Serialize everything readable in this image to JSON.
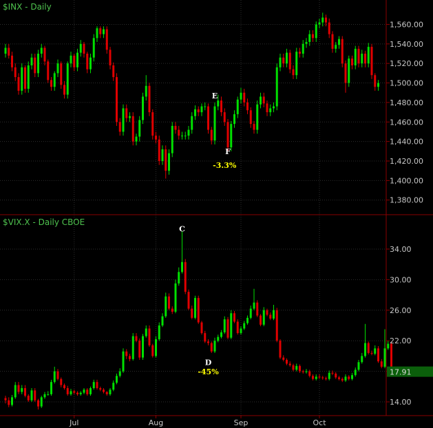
{
  "colors": {
    "background": "#000000",
    "up": "#00e000",
    "down": "#e00000",
    "grid": "#2e2e2e",
    "axis": "#8a0000",
    "text": "#c8c8c8",
    "title": "#4ec24e",
    "annotation_letter": "#ffffff",
    "annotation_pct": "#ffff00"
  },
  "chart_data": [
    {
      "type": "candlestick",
      "title": "$INX - Daily",
      "ylim": [
        1365,
        1585
      ],
      "yticks": [
        1380,
        1400,
        1420,
        1440,
        1460,
        1480,
        1500,
        1520,
        1540,
        1560
      ],
      "ytick_labels": [
        "1,380.00",
        "1,400.00",
        "1,420.00",
        "1,440.00",
        "1,460.00",
        "1,480.00",
        "1,500.00",
        "1,520.00",
        "1,540.00",
        "1,560.00"
      ],
      "grid": true,
      "annotations": [
        {
          "label": "E",
          "x": 64,
          "y": 1484
        },
        {
          "label": "F",
          "x": 68,
          "y": 1427
        },
        {
          "label": "-3.3%",
          "x": 67,
          "y": 1413
        }
      ],
      "series": {
        "close": [
          1536,
          1528,
          1516,
          1506,
          1492,
          1516,
          1494,
          1518,
          1526,
          1510,
          1530,
          1536,
          1522,
          1503,
          1496,
          1510,
          1520,
          1498,
          1488,
          1520,
          1528,
          1516,
          1531,
          1540,
          1530,
          1514,
          1526,
          1546,
          1556,
          1550,
          1555,
          1534,
          1518,
          1506,
          1460,
          1450,
          1474,
          1464,
          1466,
          1440,
          1445,
          1462,
          1486,
          1497,
          1470,
          1446,
          1442,
          1420,
          1432,
          1410,
          1428,
          1456,
          1452,
          1446,
          1446,
          1446,
          1452,
          1466,
          1473,
          1470,
          1476,
          1476,
          1452,
          1441,
          1476,
          1482,
          1470,
          1460,
          1434,
          1458,
          1468,
          1483,
          1490,
          1480,
          1472,
          1458,
          1452,
          1478,
          1486,
          1479,
          1470,
          1474,
          1476,
          1516,
          1526,
          1520,
          1531,
          1514,
          1508,
          1532,
          1530,
          1540,
          1542,
          1550,
          1546,
          1560,
          1562,
          1567,
          1562,
          1550,
          1535,
          1539,
          1545,
          1520,
          1500,
          1525,
          1518,
          1535,
          1520,
          1530,
          1520,
          1537,
          1508,
          1496,
          1500
        ],
        "open": [
          1530,
          1536,
          1528,
          1516,
          1506,
          1492,
          1516,
          1494,
          1518,
          1526,
          1510,
          1530,
          1536,
          1522,
          1503,
          1496,
          1510,
          1520,
          1498,
          1488,
          1520,
          1528,
          1516,
          1531,
          1540,
          1530,
          1514,
          1526,
          1546,
          1556,
          1550,
          1555,
          1534,
          1518,
          1506,
          1460,
          1450,
          1474,
          1464,
          1466,
          1440,
          1445,
          1462,
          1486,
          1497,
          1470,
          1446,
          1442,
          1420,
          1432,
          1410,
          1428,
          1456,
          1452,
          1446,
          1446,
          1446,
          1452,
          1466,
          1473,
          1470,
          1476,
          1476,
          1452,
          1441,
          1476,
          1482,
          1470,
          1460,
          1434,
          1458,
          1468,
          1483,
          1490,
          1480,
          1472,
          1458,
          1452,
          1478,
          1486,
          1479,
          1470,
          1474,
          1476,
          1516,
          1526,
          1520,
          1531,
          1514,
          1508,
          1532,
          1530,
          1540,
          1542,
          1550,
          1546,
          1560,
          1562,
          1567,
          1562,
          1550,
          1535,
          1539,
          1545,
          1520,
          1500,
          1525,
          1518,
          1535,
          1520,
          1530,
          1520,
          1537,
          1508,
          1496
        ],
        "high": [
          1540,
          1540,
          1532,
          1520,
          1510,
          1520,
          1518,
          1522,
          1530,
          1530,
          1534,
          1540,
          1538,
          1524,
          1506,
          1512,
          1524,
          1522,
          1502,
          1522,
          1532,
          1530,
          1535,
          1544,
          1542,
          1532,
          1530,
          1550,
          1558,
          1558,
          1558,
          1558,
          1537,
          1521,
          1510,
          1464,
          1478,
          1478,
          1470,
          1470,
          1448,
          1466,
          1490,
          1508,
          1500,
          1473,
          1450,
          1446,
          1436,
          1436,
          1432,
          1460,
          1460,
          1456,
          1450,
          1450,
          1456,
          1470,
          1477,
          1476,
          1479,
          1480,
          1479,
          1455,
          1480,
          1488,
          1486,
          1474,
          1463,
          1461,
          1472,
          1486,
          1495,
          1494,
          1484,
          1475,
          1461,
          1482,
          1490,
          1490,
          1482,
          1478,
          1480,
          1520,
          1530,
          1530,
          1535,
          1534,
          1518,
          1536,
          1536,
          1544,
          1546,
          1554,
          1554,
          1563,
          1566,
          1572,
          1570,
          1566,
          1553,
          1542,
          1548,
          1548,
          1523,
          1528,
          1528,
          1538,
          1538,
          1534,
          1533,
          1541,
          1540,
          1510,
          1503
        ],
        "low": [
          1526,
          1525,
          1512,
          1502,
          1488,
          1488,
          1490,
          1490,
          1514,
          1506,
          1506,
          1526,
          1518,
          1500,
          1492,
          1492,
          1506,
          1494,
          1484,
          1484,
          1516,
          1512,
          1512,
          1527,
          1526,
          1510,
          1510,
          1522,
          1542,
          1546,
          1546,
          1530,
          1514,
          1502,
          1456,
          1446,
          1446,
          1460,
          1460,
          1436,
          1436,
          1440,
          1458,
          1482,
          1466,
          1442,
          1438,
          1416,
          1416,
          1402,
          1406,
          1424,
          1448,
          1442,
          1442,
          1442,
          1442,
          1448,
          1462,
          1466,
          1466,
          1472,
          1448,
          1437,
          1437,
          1472,
          1466,
          1456,
          1430,
          1430,
          1454,
          1464,
          1479,
          1476,
          1468,
          1454,
          1448,
          1448,
          1474,
          1475,
          1466,
          1466,
          1470,
          1472,
          1512,
          1516,
          1516,
          1510,
          1504,
          1504,
          1526,
          1526,
          1536,
          1538,
          1542,
          1542,
          1556,
          1558,
          1558,
          1546,
          1531,
          1531,
          1535,
          1516,
          1490,
          1496,
          1514,
          1514,
          1516,
          1516,
          1516,
          1516,
          1504,
          1492,
          1492
        ]
      }
    },
    {
      "type": "candlestick",
      "title": "$VIX.X - Daily  CBOE",
      "ylim": [
        12.2,
        38.5
      ],
      "yticks": [
        14,
        18,
        22,
        26,
        30,
        34
      ],
      "ytick_labels": [
        "14.00",
        "18.00",
        "22.00",
        "26.00",
        "30.00",
        "34.00"
      ],
      "grid": true,
      "last_value": "17.91",
      "x_labels": [
        "Jul",
        "Aug",
        "Sep",
        "Oct"
      ],
      "x_label_index": [
        21,
        46,
        72,
        96
      ],
      "annotations": [
        {
          "label": "C",
          "x": 54,
          "y": 36.3
        },
        {
          "label": "D",
          "x": 62,
          "y": 18.8
        },
        {
          "label": "-45%",
          "x": 62,
          "y": 17.6
        }
      ],
      "series": {
        "close": [
          14.2,
          13.6,
          14.6,
          16.2,
          15.3,
          15.8,
          14.8,
          14.2,
          15.5,
          14.2,
          13.4,
          14.6,
          15.0,
          15.0,
          16.6,
          18.0,
          17.0,
          16.2,
          15.8,
          15.0,
          15.4,
          15.2,
          15.0,
          15.2,
          15.6,
          15.0,
          15.8,
          16.6,
          15.8,
          15.6,
          15.3,
          15.0,
          15.6,
          16.5,
          17.4,
          18.0,
          20.6,
          20.0,
          19.6,
          22.6,
          22.0,
          19.8,
          22.6,
          23.6,
          21.4,
          20.0,
          22.2,
          24.0,
          25.2,
          27.8,
          26.2,
          25.8,
          29.5,
          31.0,
          32.3,
          28.4,
          26.2,
          25.0,
          27.6,
          24.4,
          23.0,
          21.9,
          21.7,
          20.6,
          22.0,
          22.5,
          23.1,
          24.8,
          22.4,
          25.6,
          24.5,
          23.0,
          23.6,
          24.3,
          25.0,
          26.2,
          27.0,
          25.3,
          24.1,
          26.0,
          25.4,
          24.9,
          26.0,
          22.0,
          19.8,
          19.5,
          19.0,
          18.8,
          18.2,
          18.7,
          18.0,
          17.9,
          18.0,
          17.4,
          17.0,
          17.3,
          17.2,
          17.1,
          17.0,
          17.8,
          17.7,
          17.2,
          17.0,
          16.8,
          17.3,
          17.0,
          17.5,
          18.2,
          19.2,
          20.0,
          21.7,
          20.4,
          20.3,
          21.0,
          19.3,
          18.6,
          21.0,
          21.6,
          17.9
        ],
        "open": [
          14.5,
          14.2,
          13.6,
          14.6,
          16.2,
          15.3,
          15.8,
          14.8,
          14.2,
          15.5,
          14.2,
          13.4,
          14.6,
          15.0,
          15.0,
          16.6,
          18.0,
          17.0,
          16.2,
          15.8,
          15.0,
          15.4,
          15.2,
          15.0,
          15.2,
          15.6,
          15.0,
          15.8,
          16.6,
          15.8,
          15.6,
          15.3,
          15.0,
          15.6,
          16.5,
          17.4,
          18.0,
          20.6,
          20.0,
          19.6,
          22.6,
          22.0,
          19.8,
          22.6,
          23.6,
          21.4,
          20.0,
          22.2,
          24.0,
          25.2,
          27.8,
          26.2,
          25.8,
          29.5,
          31.0,
          32.3,
          28.4,
          26.2,
          25.0,
          27.6,
          24.4,
          23.0,
          21.9,
          21.7,
          20.6,
          22.0,
          22.5,
          23.1,
          24.8,
          22.4,
          25.6,
          24.5,
          23.0,
          23.6,
          24.3,
          25.0,
          26.2,
          27.0,
          25.3,
          24.1,
          26.0,
          25.4,
          24.9,
          26.0,
          22.0,
          19.8,
          19.5,
          19.0,
          18.8,
          18.2,
          18.7,
          18.0,
          17.9,
          18.0,
          17.4,
          17.0,
          17.3,
          17.2,
          17.1,
          17.0,
          17.8,
          17.7,
          17.2,
          17.0,
          16.8,
          17.3,
          17.0,
          17.5,
          18.2,
          19.2,
          20.0,
          21.7,
          20.4,
          20.3,
          21.0,
          19.3,
          18.6,
          21.0,
          21.6
        ],
        "high": [
          14.8,
          14.6,
          14.9,
          16.6,
          16.6,
          16.2,
          16.2,
          15.0,
          15.8,
          15.8,
          14.4,
          14.8,
          15.3,
          15.4,
          16.9,
          18.6,
          18.3,
          17.2,
          16.4,
          16.1,
          15.7,
          15.6,
          15.4,
          15.4,
          15.8,
          15.8,
          16.0,
          16.9,
          16.9,
          16.0,
          15.8,
          15.4,
          15.8,
          16.8,
          17.7,
          18.4,
          21.0,
          20.9,
          20.3,
          23.0,
          23.0,
          22.3,
          22.9,
          24.0,
          24.0,
          21.6,
          22.6,
          24.4,
          25.6,
          28.3,
          28.2,
          26.5,
          30.0,
          31.6,
          36.3,
          32.7,
          28.7,
          26.6,
          27.9,
          27.9,
          24.6,
          23.3,
          22.2,
          21.9,
          22.4,
          22.8,
          23.4,
          25.2,
          25.1,
          26.0,
          25.9,
          24.8,
          23.9,
          24.6,
          25.3,
          26.6,
          28.8,
          27.3,
          25.5,
          26.4,
          26.2,
          25.7,
          26.7,
          26.3,
          22.2,
          20.1,
          19.7,
          19.3,
          19.0,
          19.0,
          18.9,
          18.2,
          18.3,
          18.2,
          17.6,
          17.6,
          17.6,
          17.4,
          17.3,
          18.1,
          18.1,
          17.9,
          17.4,
          17.2,
          17.6,
          17.5,
          17.8,
          18.5,
          19.5,
          20.4,
          24.2,
          21.9,
          20.7,
          21.4,
          21.3,
          19.6,
          23.5,
          22.0,
          21.9
        ],
        "low": [
          13.8,
          13.3,
          13.4,
          14.4,
          15.0,
          15.0,
          14.6,
          14.0,
          14.0,
          14.0,
          13.0,
          13.2,
          14.4,
          14.8,
          14.8,
          16.4,
          16.8,
          15.9,
          15.6,
          14.8,
          14.8,
          15.0,
          14.8,
          14.8,
          15.0,
          14.8,
          14.8,
          15.6,
          15.6,
          15.4,
          15.1,
          14.8,
          14.8,
          15.4,
          16.3,
          17.2,
          17.8,
          19.6,
          19.3,
          19.4,
          21.8,
          19.5,
          19.5,
          22.4,
          21.2,
          19.8,
          19.8,
          22.0,
          23.8,
          25.0,
          26.0,
          25.5,
          25.6,
          29.2,
          30.8,
          28.1,
          26.0,
          24.8,
          24.8,
          24.2,
          22.8,
          21.7,
          21.4,
          20.4,
          20.4,
          21.8,
          22.3,
          22.9,
          22.2,
          22.2,
          24.3,
          22.8,
          22.8,
          23.4,
          24.1,
          24.8,
          26.0,
          25.1,
          23.9,
          23.9,
          25.2,
          24.7,
          24.7,
          21.8,
          19.6,
          19.3,
          18.8,
          18.6,
          18.0,
          18.0,
          17.8,
          17.7,
          17.7,
          17.2,
          16.8,
          16.8,
          17.0,
          16.9,
          16.8,
          16.8,
          17.5,
          17.0,
          16.8,
          16.6,
          16.6,
          16.8,
          16.8,
          17.3,
          18.0,
          19.0,
          19.8,
          20.2,
          20.1,
          20.1,
          19.1,
          18.4,
          18.4,
          20.8,
          17.7
        ]
      }
    }
  ]
}
